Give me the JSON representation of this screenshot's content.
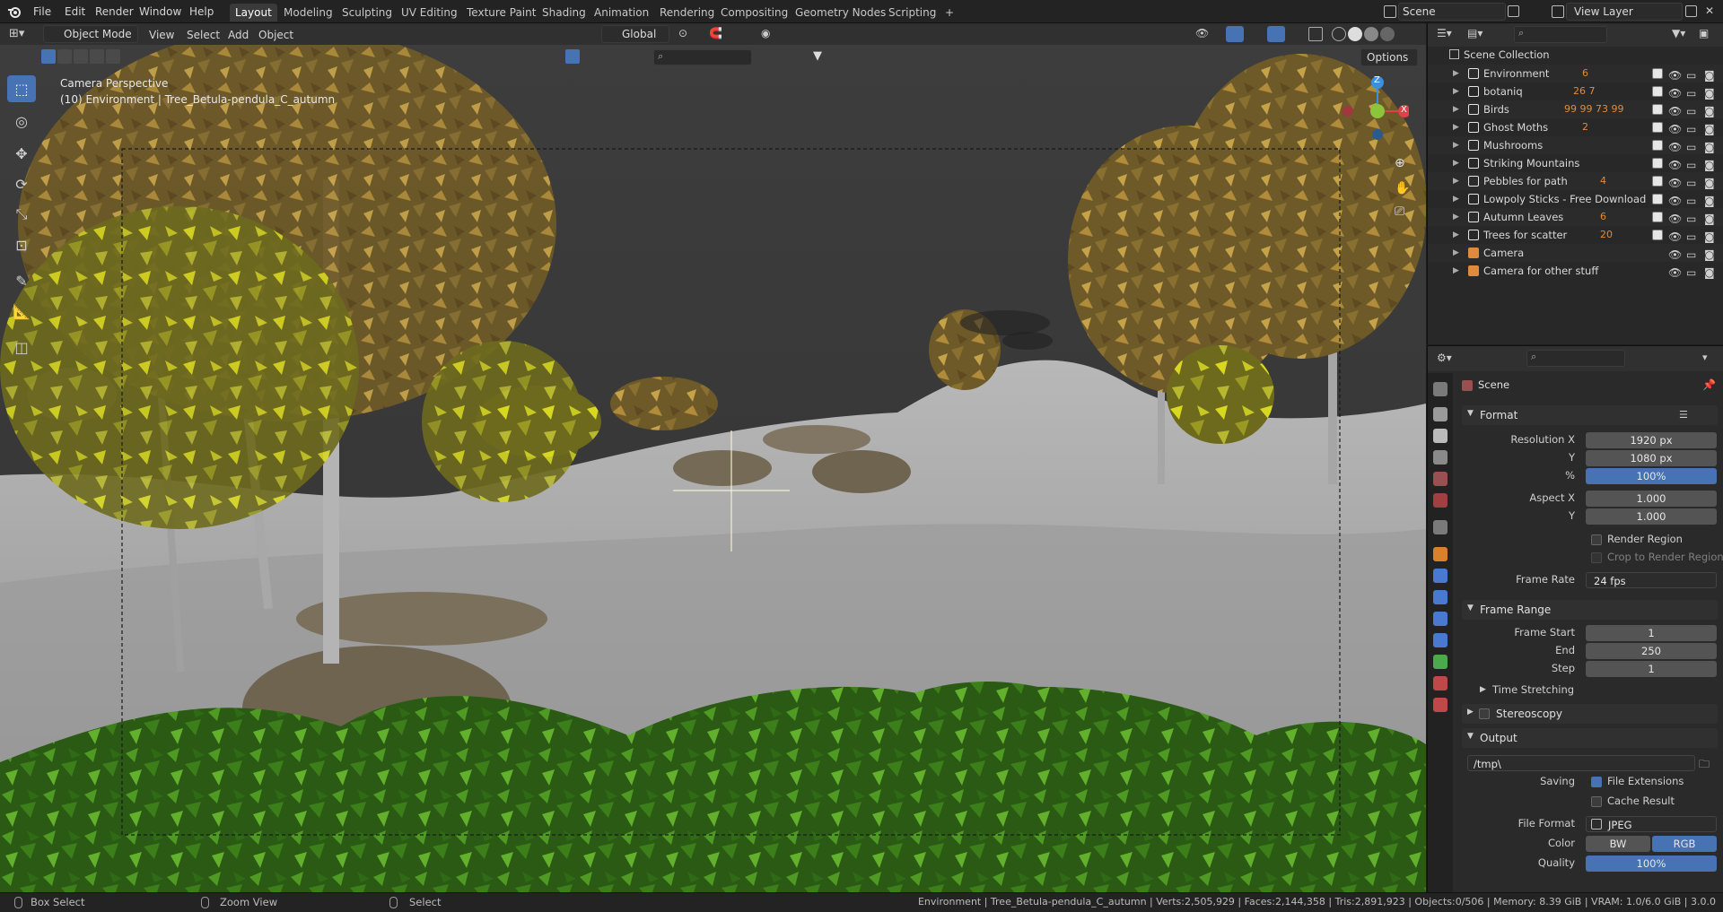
{
  "app": {
    "menus": [
      "File",
      "Edit",
      "Render",
      "Window",
      "Help"
    ],
    "workspaces": [
      "Layout",
      "Modeling",
      "Sculpting",
      "UV Editing",
      "Texture Paint",
      "Shading",
      "Animation",
      "Rendering",
      "Compositing",
      "Geometry Nodes",
      "Scripting"
    ],
    "active_workspace": "Layout",
    "add_workspace": "+",
    "scene_field": "Scene",
    "view_layer_field": "View Layer"
  },
  "viewport": {
    "mode": "Object Mode",
    "menus": [
      "View",
      "Select",
      "Add",
      "Object"
    ],
    "transform_orientation": "Global",
    "options_label": "Options",
    "overlay_title": "Camera Perspective",
    "overlay_subtitle": "(10) Environment | Tree_Betula-pendula_C_autumn",
    "gizmo_axes": {
      "z": "Z",
      "x": "X"
    }
  },
  "outliner": {
    "root": "Scene Collection",
    "items": [
      {
        "label": "Environment",
        "badge": "6",
        "type": "collection"
      },
      {
        "label": "botaniq",
        "badge": "26 7",
        "type": "collection"
      },
      {
        "label": "Birds",
        "badge": "99 99 73 99",
        "type": "collection"
      },
      {
        "label": "Ghost Moths",
        "badge": "2",
        "type": "collection"
      },
      {
        "label": "Mushrooms",
        "badge": "",
        "type": "collection"
      },
      {
        "label": "Striking Mountains",
        "badge": "",
        "type": "collection"
      },
      {
        "label": "Pebbles for path",
        "badge": "4",
        "type": "collection"
      },
      {
        "label": "Lowpoly Sticks - Free Download",
        "badge": "",
        "type": "collection"
      },
      {
        "label": "Autumn Leaves",
        "badge": "6",
        "type": "collection"
      },
      {
        "label": "Trees for scatter",
        "badge": "20",
        "type": "collection"
      },
      {
        "label": "Camera",
        "badge": "",
        "type": "camera"
      },
      {
        "label": "Camera for other stuff",
        "badge": "",
        "type": "camera"
      }
    ]
  },
  "properties": {
    "context": "Scene",
    "format": {
      "title": "Format",
      "resolution_x_label": "Resolution X",
      "resolution_x": "1920 px",
      "y_label": "Y",
      "resolution_y": "1080 px",
      "percent_label": "%",
      "percent": "100%",
      "aspect_x_label": "Aspect X",
      "aspect_x": "1.000",
      "aspect_y_label": "Y",
      "aspect_y": "1.000",
      "render_region": "Render Region",
      "crop_region": "Crop to Render Region",
      "frame_rate_label": "Frame Rate",
      "frame_rate": "24 fps"
    },
    "frame_range": {
      "title": "Frame Range",
      "start_label": "Frame Start",
      "start": "1",
      "end_label": "End",
      "end": "250",
      "step_label": "Step",
      "step": "1",
      "time_stretching": "Time Stretching"
    },
    "stereoscopy": "Stereoscopy",
    "output": {
      "title": "Output",
      "path": "/tmp\\",
      "saving_label": "Saving",
      "file_extensions": "File Extensions",
      "cache_result": "Cache Result",
      "file_format_label": "File Format",
      "file_format": "JPEG",
      "color_label": "Color",
      "color_bw": "BW",
      "color_rgb": "RGB",
      "quality_label": "Quality",
      "quality": "100%"
    }
  },
  "statusbar": {
    "box_select": "Box Select",
    "zoom_view": "Zoom View",
    "select": "Select",
    "stats": "Environment | Tree_Betula-pendula_C_autumn | Verts:2,505,929 | Faces:2,144,358 | Tris:2,891,923 | Objects:0/506 | Memory: 8.39 GiB | VRAM: 1.0/6.0 GiB | 3.0.0"
  },
  "colors": {
    "accent": "#4772b3",
    "collection_icon": "#e6e6e6",
    "camera_icon": "#e08a3c",
    "badge_orange": "#e08a3c",
    "gizmo_x": "#e0404a",
    "gizmo_y": "#8cc43c",
    "gizmo_z": "#3a8fe0"
  }
}
